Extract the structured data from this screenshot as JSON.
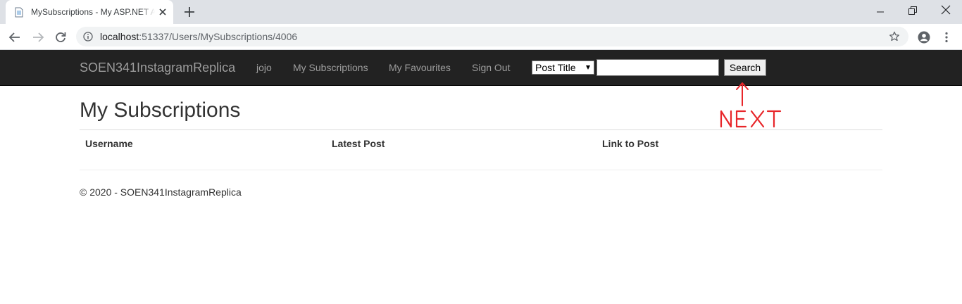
{
  "browser": {
    "tab_title": "MySubscriptions - My ASP.NET Application",
    "url_host": "localhost",
    "url_rest": ":51337/Users/MySubscriptions/4006",
    "icons": [
      "page-icon",
      "close-icon",
      "plus-icon",
      "back-icon",
      "forward-icon",
      "reload-icon",
      "info-icon",
      "star-icon",
      "account-icon",
      "kebab-menu-icon",
      "minimize-icon",
      "restore-icon",
      "window-close-icon"
    ]
  },
  "navbar": {
    "brand": "SOEN341InstagramReplica",
    "links": [
      "jojo",
      "My Subscriptions",
      "My Favourites",
      "Sign Out"
    ],
    "search_type": "Post Title",
    "search_value": "",
    "search_button": "Search"
  },
  "page": {
    "title": "My Subscriptions",
    "columns": [
      "Username",
      "Latest Post",
      "Link to Post"
    ],
    "rows": []
  },
  "footer": {
    "text": "© 2020 - SOEN341InstagramReplica"
  },
  "annotation": {
    "text": "NEXT",
    "color": "#e8262a"
  },
  "colors": {
    "navbar_bg": "#222222",
    "nav_link": "#9d9d9d",
    "tabstrip_bg": "#dee1e6"
  }
}
